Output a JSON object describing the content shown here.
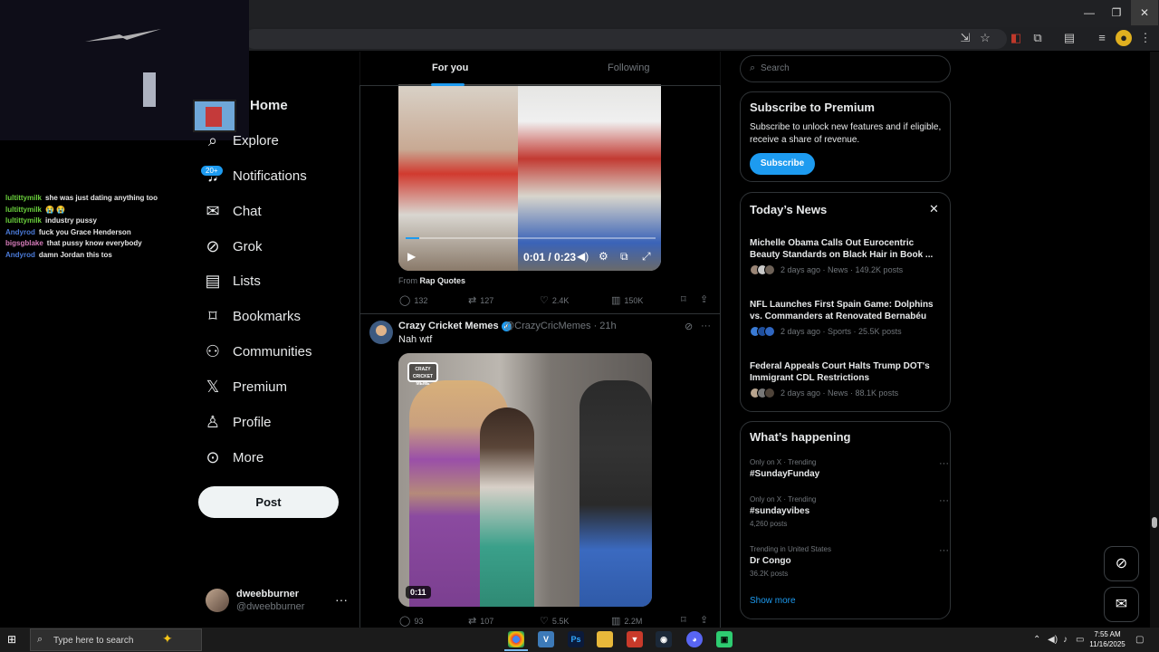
{
  "window": {
    "minimize": "—",
    "restore": "❐",
    "close": "✕"
  },
  "stream_chat": [
    {
      "user": "lultittymilk",
      "color": "u-g",
      "text": "she was just dating anything too"
    },
    {
      "user": "lultittymilk",
      "color": "u-g",
      "text": "😭 😭"
    },
    {
      "user": "lultittymilk",
      "color": "u-g",
      "text": "industry pussy"
    },
    {
      "user": "Andyrod",
      "color": "u-b",
      "text": "fuck you Grace Henderson"
    },
    {
      "user": "bigsgblake",
      "color": "u-p",
      "text": "that pussy know everybody"
    },
    {
      "user": "Andyrod",
      "color": "u-b",
      "text": "damn Jordan this tos"
    }
  ],
  "nav": {
    "home": "Home",
    "explore": "Explore",
    "notifications": "Notifications",
    "notifications_badge": "20+",
    "chat": "Chat",
    "grok": "Grok",
    "lists": "Lists",
    "bookmarks": "Bookmarks",
    "communities": "Communities",
    "premium": "Premium",
    "profile": "Profile",
    "more": "More",
    "post": "Post"
  },
  "account": {
    "name": "dweebburner",
    "handle": "@dweebburner",
    "menu": "···"
  },
  "tabs": {
    "for_you": "For you",
    "following": "Following"
  },
  "tweet1": {
    "video_time": "0:01 / 0:23",
    "from_label": "From",
    "from_source": "Rap Quotes",
    "replies": "132",
    "reposts": "127",
    "likes": "2.4K",
    "views": "150K"
  },
  "tweet2": {
    "name": "Crazy Cricket Memes",
    "handle": "@CrazyCricMemes",
    "time": "· 21h",
    "text": "Nah wtf",
    "watermark": "CRAZY CRICKET MEME",
    "duration": "0:11",
    "replies": "93",
    "reposts": "107",
    "likes": "5.5K",
    "views": "2.2M"
  },
  "search": {
    "placeholder": "Search"
  },
  "premium_card": {
    "title": "Subscribe to Premium",
    "desc": "Subscribe to unlock new features and if eligible, receive a share of revenue.",
    "button": "Subscribe"
  },
  "news_card": {
    "title": "Today’s News",
    "close": "✕",
    "items": [
      {
        "headline": "Michelle Obama Calls Out Eurocentric Beauty Standards on Black Hair in Book ...",
        "meta": "2 days ago · News · 149.2K posts"
      },
      {
        "headline": "NFL Launches First Spain Game: Dolphins vs. Commanders at Renovated Bernabéu",
        "meta": "2 days ago · Sports · 25.5K posts"
      },
      {
        "headline": "Federal Appeals Court Halts Trump DOT's Immigrant CDL Restrictions",
        "meta": "2 days ago · News · 88.1K posts"
      }
    ]
  },
  "happening": {
    "title": "What’s happening",
    "items": [
      {
        "context": "Only on X · Trending",
        "topic": "#SundayFunday",
        "posts": ""
      },
      {
        "context": "Only on X · Trending",
        "topic": "#sundayvibes",
        "posts": "4,260 posts"
      },
      {
        "context": "Trending in United States",
        "topic": "Dr Congo",
        "posts": "36.2K posts"
      }
    ],
    "show_more": "Show more"
  },
  "taskbar": {
    "search_placeholder": "Type here to search",
    "time": "7:55 AM",
    "date": "11/16/2025"
  },
  "colors": {
    "accent": "#1d9bf0",
    "background": "#000000",
    "border": "#2f3336",
    "muted": "#71767b"
  }
}
